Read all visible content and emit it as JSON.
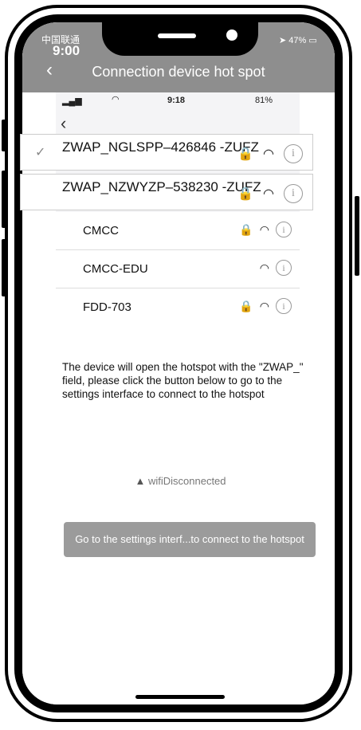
{
  "status": {
    "carrier": "中国联通",
    "time": "9:00",
    "battery": "47%"
  },
  "nav": {
    "back_icon": "chevron-left",
    "title": "Connection device hot spot"
  },
  "embedded_status": {
    "time": "9:18",
    "battery": "81%"
  },
  "networks_highlighted": [
    {
      "name": "ZWAP_NGLSPP–426846 -ZUFZ",
      "selected": true
    },
    {
      "name": "ZWAP_NZWYZP–538230 -ZUFZ",
      "selected": false
    }
  ],
  "networks": [
    {
      "name": "CMCC",
      "locked": true
    },
    {
      "name": "CMCC-EDU",
      "locked": false
    },
    {
      "name": "FDD-703",
      "locked": true
    }
  ],
  "description": "The device will open the hotspot with the \"ZWAP_\" field, please click the button below to go to the settings interface to connect to the hotspot",
  "wifi_status": "wifiDisconnected",
  "button_label": "Go to the settings interf...to connect to the hotspot"
}
